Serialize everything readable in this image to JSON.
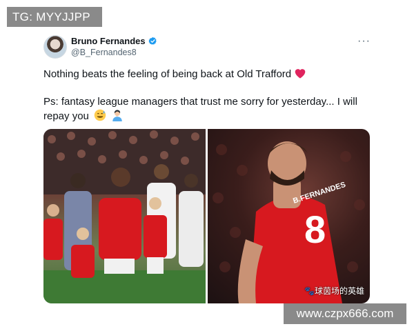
{
  "overlay": {
    "top_left_label": "TG: MYYJJPP",
    "bottom_right_label": "www.czpx666.com"
  },
  "tweet": {
    "author": {
      "name": "Bruno Fernandes",
      "handle": "@B_Fernandes8",
      "verified": true,
      "avatar_icon": "avatar-photo"
    },
    "more_label": "···",
    "text": {
      "line1": "Nothing beats the feeling of being back at Old Trafford",
      "line2": "Ps: fantasy league managers that trust me sorry for yesterday... I will",
      "line3": "repay you",
      "emojis": [
        "red-heart-icon",
        "grinning-sweat-face-icon",
        "person-facepalming-icon"
      ]
    },
    "media": {
      "count": 2,
      "right_watermark": "🐾球茵场的英雄",
      "jersey_name": "B.FERNANDES",
      "jersey_number": "8"
    }
  },
  "colors": {
    "verified_blue": "#1d9bf0",
    "heart_red": "#e0245e",
    "overlay_gray": "#8a8a8a",
    "kit_red": "#d7191f"
  }
}
